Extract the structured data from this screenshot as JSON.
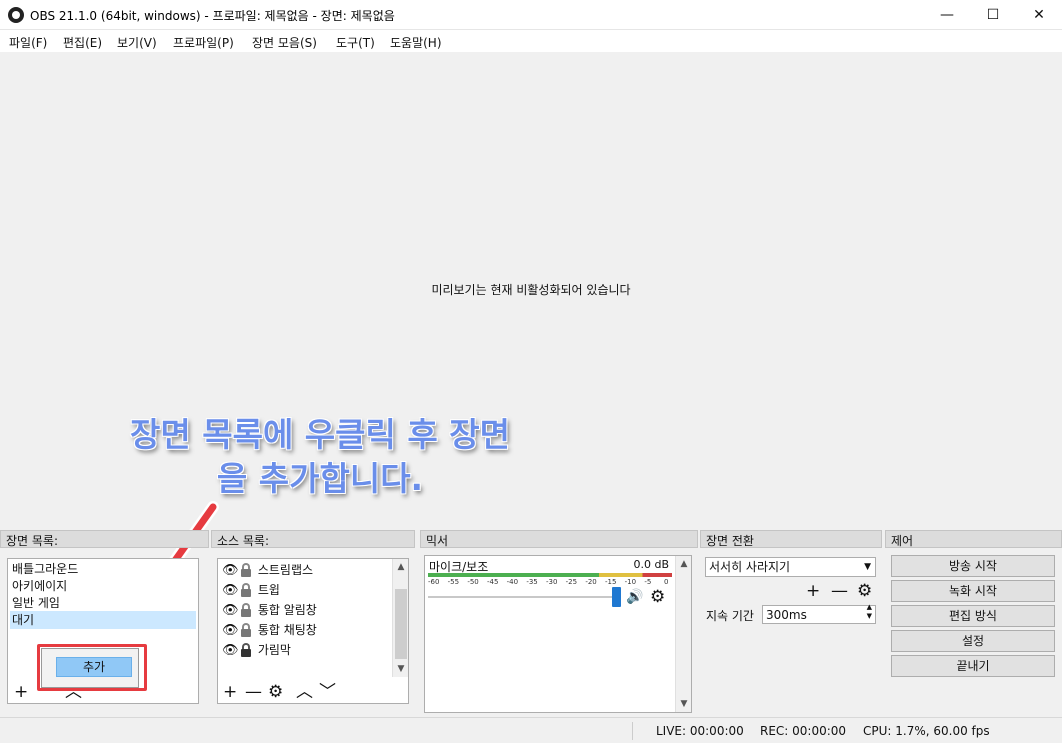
{
  "window": {
    "title": "OBS 21.1.0 (64bit, windows) - 프로파일: 제목없음 - 장면: 제목없음",
    "controls": {
      "minimize": "—",
      "maximize": "☐",
      "close": "✕"
    }
  },
  "menu": [
    "파일(F)",
    "편집(E)",
    "보기(V)",
    "프로파일(P)",
    "장면 모음(S)",
    "도구(T)",
    "도움말(H)"
  ],
  "preview": {
    "message": "미리보기는 현재 비활성화되어 있습니다"
  },
  "annotation": {
    "line1": "장면 목록에 우클릭 후 장면",
    "line2": "을 추가합니다.",
    "color": "#6a8eea",
    "arrow_color": "#e63b40"
  },
  "scenes": {
    "header": "장면 목록:",
    "items": [
      "배틀그라운드",
      "아키에이지",
      "일반 게임",
      "대기"
    ],
    "selected": "대기",
    "context_menu": {
      "item": "추가"
    }
  },
  "sources": {
    "header": "소스 목록:",
    "items": [
      {
        "name": "스트림랩스",
        "locked": false
      },
      {
        "name": "트윕",
        "locked": false
      },
      {
        "name": "통합 알림창",
        "locked": false
      },
      {
        "name": "통합 채팅창",
        "locked": false
      },
      {
        "name": "가림막",
        "locked": true
      }
    ]
  },
  "mixer": {
    "header": "믹서",
    "channel": {
      "name": "마이크/보조",
      "level": "0.0 dB"
    },
    "scale": [
      "-60",
      "-55",
      "-50",
      "-45",
      "-40",
      "-35",
      "-30",
      "-25",
      "-20",
      "-15",
      "-10",
      "-5",
      "0"
    ],
    "volume_fraction": 1.0
  },
  "transitions": {
    "header": "장면 전환",
    "selected": "서서히 사라지기",
    "duration_label": "지속 기간",
    "duration_value": "300ms"
  },
  "controls": {
    "header": "제어",
    "buttons": [
      "방송 시작",
      "녹화 시작",
      "편집 방식",
      "설정",
      "끝내기"
    ]
  },
  "status": {
    "live": "LIVE: 00:00:00",
    "rec": "REC: 00:00:00",
    "cpu": "CPU: 1.7%, 60.00 fps"
  },
  "icons": {
    "add": "+",
    "remove": "—",
    "up": "︿",
    "down": "﹀",
    "gear": "⚙",
    "eye": "👁",
    "speaker": "🔊"
  }
}
